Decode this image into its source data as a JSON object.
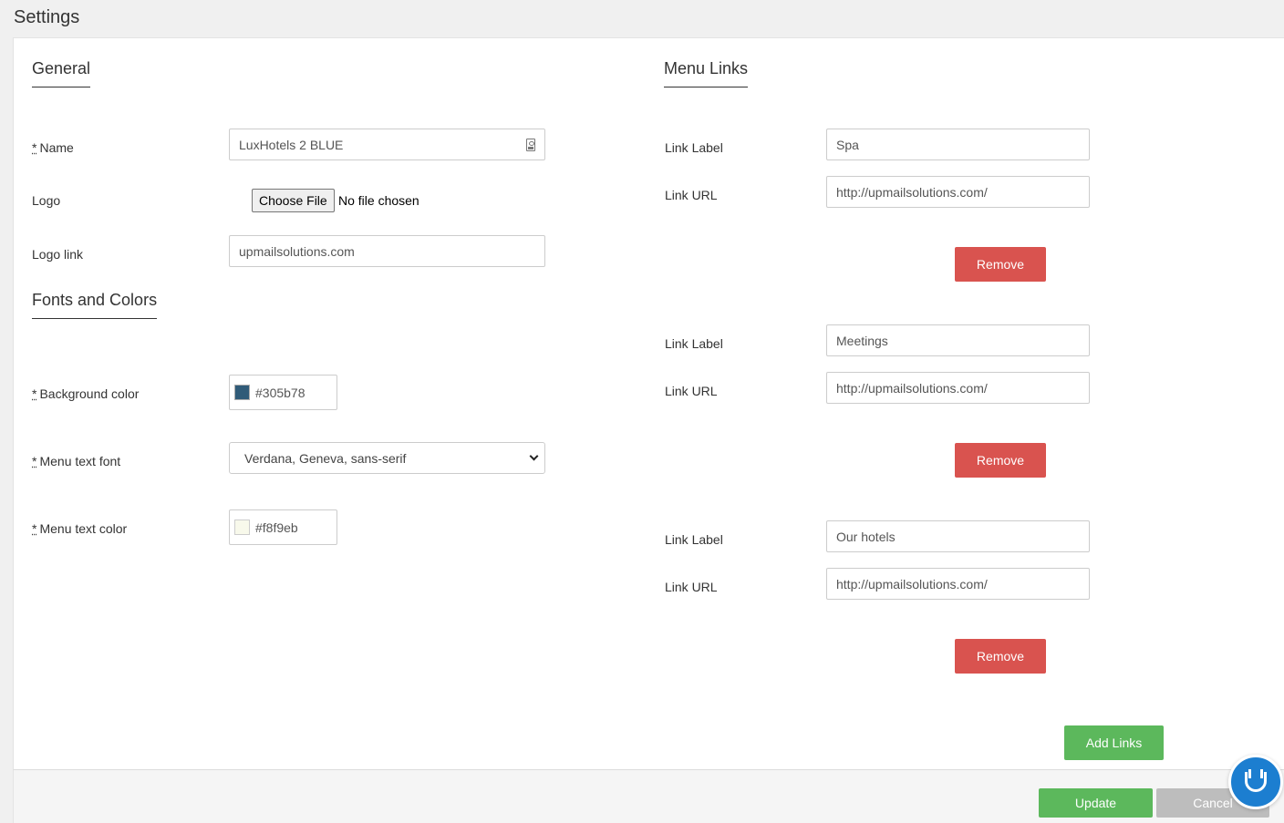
{
  "page": {
    "title": "Settings"
  },
  "general": {
    "title": "General",
    "required_mark": "*",
    "name_label": "Name",
    "name_value": "LuxHotels 2 BLUE",
    "logo_label": "Logo",
    "logo_button": "Choose File",
    "logo_status": "No file chosen",
    "logo_link_label": "Logo link",
    "logo_link_value": "upmailsolutions.com"
  },
  "fonts_colors": {
    "title": "Fonts and Colors",
    "bg_color_label": "Background color",
    "bg_color_value": "#305b78",
    "menu_font_label": "Menu text font",
    "menu_font_value": "Verdana, Geneva, sans-serif",
    "menu_color_label": "Menu text color",
    "menu_color_value": "#f8f9eb"
  },
  "menu_links": {
    "title": "Menu Links",
    "label_caption": "Link Label",
    "url_caption": "Link URL",
    "remove_label": "Remove",
    "links": [
      {
        "label": "Spa",
        "url": "http://upmailsolutions.com/"
      },
      {
        "label": "Meetings",
        "url": "http://upmailsolutions.com/"
      },
      {
        "label": "Our hotels",
        "url": "http://upmailsolutions.com/"
      }
    ],
    "add_label": "Add Links"
  },
  "footer": {
    "update_label": "Update",
    "cancel_label": "Cancel"
  },
  "colors": {
    "remove": "#d9534f",
    "success": "#5cb85c",
    "chat": "#1c7ed0"
  },
  "icons": {
    "name_field": "contact-card-icon",
    "select": "chevron-down-icon",
    "chat": "chat-widget-icon"
  }
}
